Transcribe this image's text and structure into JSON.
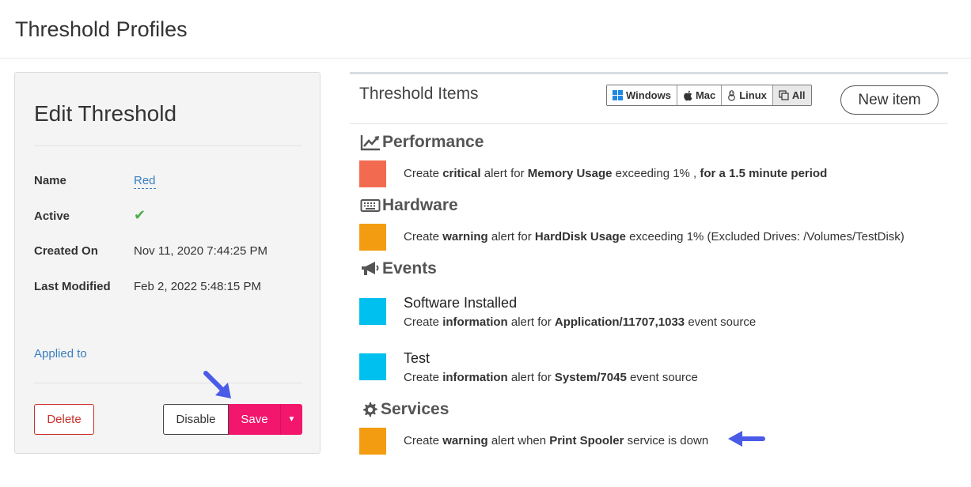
{
  "page": {
    "title": "Threshold Profiles"
  },
  "edit": {
    "title": "Edit Threshold",
    "fields": [
      {
        "label": "Name",
        "value": "Red"
      },
      {
        "label": "Active",
        "value": "✔"
      },
      {
        "label": "Created On",
        "value": "Nov 11, 2020 7:44:25 PM"
      },
      {
        "label": "Last Modified",
        "value": "Feb 2, 2022 5:48:15 PM"
      }
    ],
    "applied_to": "Applied to",
    "buttons": {
      "delete": "Delete",
      "disable": "Disable",
      "save": "Save"
    }
  },
  "items": {
    "title": "Threshold Items",
    "os_filters": [
      "Windows",
      "Mac",
      "Linux",
      "All"
    ],
    "new_item": "New item",
    "sections": [
      {
        "name": "Performance",
        "entries": [
          {
            "color": "#f26b50",
            "pre": "Create ",
            "level": "critical",
            "mid": " alert for ",
            "target": "Memory Usage",
            "post": " exceeding 1% , ",
            "extra": "for a 1.5 minute period"
          }
        ]
      },
      {
        "name": "Hardware",
        "entries": [
          {
            "color": "#f39c12",
            "pre": "Create ",
            "level": "warning",
            "mid": " alert for ",
            "target": "HardDisk Usage",
            "post": " exceeding 1% (Excluded Drives: /Volumes/TestDisk)"
          }
        ]
      },
      {
        "name": "Events",
        "entries": [
          {
            "color": "#00c0ef",
            "title": "Software Installed",
            "pre": "Create ",
            "level": "information",
            "mid": " alert for ",
            "target": "Application/11707,1033",
            "post": " event source"
          },
          {
            "color": "#00c0ef",
            "title": "Test",
            "pre": "Create ",
            "level": "information",
            "mid": " alert for ",
            "target": "System/7045",
            "post": " event source"
          }
        ]
      },
      {
        "name": "Services",
        "entries": [
          {
            "color": "#f39c12",
            "pre": "Create ",
            "level": "warning",
            "mid": " alert when ",
            "target": "Print Spooler",
            "post": " service is down"
          }
        ]
      }
    ]
  },
  "colors": {
    "accent": "#f2166d",
    "link": "#3a7fc0",
    "arrow": "#4a5be8"
  }
}
